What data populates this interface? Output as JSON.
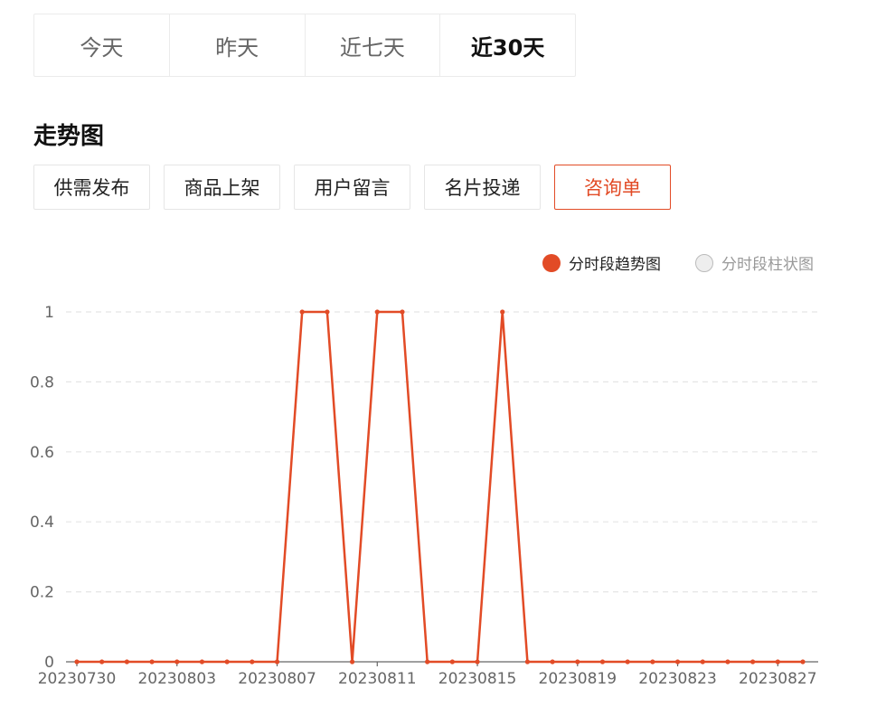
{
  "period_tabs": [
    {
      "label": "今天",
      "active": false
    },
    {
      "label": "昨天",
      "active": false
    },
    {
      "label": "近七天",
      "active": false
    },
    {
      "label": "近30天",
      "active": true
    }
  ],
  "section_title": "走势图",
  "metric_buttons": [
    {
      "label": "供需发布",
      "active": false
    },
    {
      "label": "商品上架",
      "active": false
    },
    {
      "label": "用户留言",
      "active": false
    },
    {
      "label": "名片投递",
      "active": false
    },
    {
      "label": "咨询单",
      "active": true
    }
  ],
  "legend": [
    {
      "label": "分时段趋势图",
      "active": true,
      "color": "#e24b26"
    },
    {
      "label": "分时段柱状图",
      "active": false,
      "color": "#cccccc"
    }
  ],
  "colors": {
    "accent": "#e24b26",
    "grid": "#e5e5e5",
    "axis": "#666666"
  },
  "chart_data": {
    "type": "line",
    "x": [
      "20230730",
      "20230731",
      "20230801",
      "20230802",
      "20230803",
      "20230804",
      "20230805",
      "20230806",
      "20230807",
      "20230808",
      "20230809",
      "20230810",
      "20230811",
      "20230812",
      "20230813",
      "20230814",
      "20230815",
      "20230816",
      "20230817",
      "20230818",
      "20230819",
      "20230820",
      "20230821",
      "20230822",
      "20230823",
      "20230824",
      "20230825",
      "20230826",
      "20230827",
      "20230828"
    ],
    "series": [
      {
        "values": [
          0,
          0,
          0,
          0,
          0,
          0,
          0,
          0,
          0,
          1,
          1,
          0,
          1,
          1,
          0,
          0,
          0,
          1,
          0,
          0,
          0,
          0,
          0,
          0,
          0,
          0,
          0,
          0,
          0,
          0
        ]
      }
    ],
    "x_tick_labels": [
      "20230730",
      "20230803",
      "20230807",
      "20230811",
      "20230815",
      "20230819",
      "20230823",
      "20230827"
    ],
    "y_ticks": [
      0,
      0.2,
      0.4,
      0.6,
      0.8,
      1
    ],
    "y_tick_labels": [
      "0",
      "0.2",
      "0.4",
      "0.6",
      "0.8",
      "1"
    ],
    "ylim": [
      0,
      1
    ],
    "grid": true
  }
}
